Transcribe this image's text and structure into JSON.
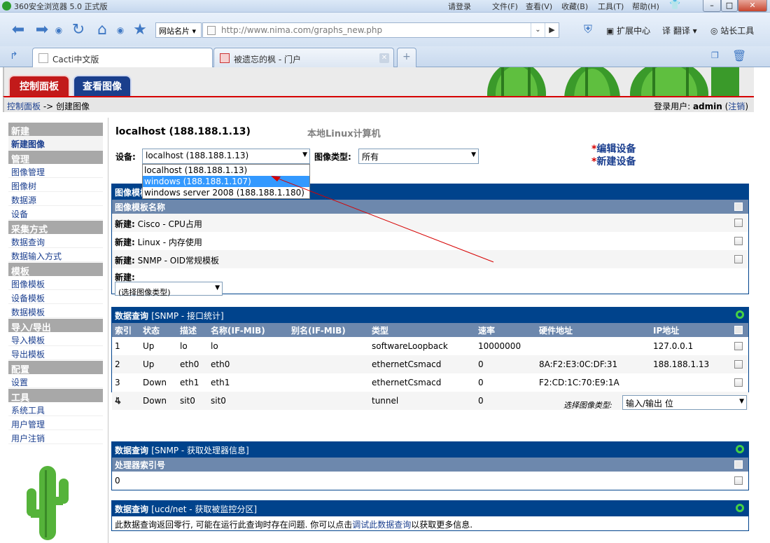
{
  "browser": {
    "title": "360安全浏览器 5.0 正式版",
    "menu": [
      "请登录",
      "文件(F)",
      "查看(V)",
      "收藏(B)",
      "工具(T)",
      "帮助(H)"
    ],
    "address_combo": "网站名片",
    "url": "http://www.nima.com/graphs_new.php",
    "tools": {
      "ext": "扩展中心",
      "translate": "翻译",
      "webmaster": "站长工具"
    },
    "tabs": [
      {
        "label": "Cacti中文版"
      },
      {
        "label": "被遗忘的枫 - 门户"
      }
    ]
  },
  "cacti": {
    "tabs": {
      "console": "控制面板",
      "graphs": "查看图像"
    },
    "breadcrumb": {
      "home": "控制面板",
      "sep": " -> ",
      "current": "创建图像"
    },
    "user": {
      "prefix": "登录用户: ",
      "name": "admin",
      "logout": "注销"
    }
  },
  "sidebar": [
    {
      "type": "head",
      "label": "新建"
    },
    {
      "type": "item",
      "label": "新建图像",
      "active": true
    },
    {
      "type": "head",
      "label": "管理"
    },
    {
      "type": "item",
      "label": "图像管理"
    },
    {
      "type": "item",
      "label": "图像树"
    },
    {
      "type": "item",
      "label": "数据源"
    },
    {
      "type": "item",
      "label": "设备"
    },
    {
      "type": "head",
      "label": "采集方式"
    },
    {
      "type": "item",
      "label": "数据查询"
    },
    {
      "type": "item",
      "label": "数据输入方式"
    },
    {
      "type": "head",
      "label": "模板"
    },
    {
      "type": "item",
      "label": "图像模板"
    },
    {
      "type": "item",
      "label": "设备模板"
    },
    {
      "type": "item",
      "label": "数据模板"
    },
    {
      "type": "head",
      "label": "导入/导出"
    },
    {
      "type": "item",
      "label": "导入模板"
    },
    {
      "type": "item",
      "label": "导出模板"
    },
    {
      "type": "head",
      "label": "配置"
    },
    {
      "type": "item",
      "label": "设置"
    },
    {
      "type": "head",
      "label": "工具"
    },
    {
      "type": "item",
      "label": "系统工具"
    },
    {
      "type": "item",
      "label": "用户管理"
    },
    {
      "type": "item",
      "label": "用户注销"
    }
  ],
  "main": {
    "host_title": "localhost (188.188.1.13)",
    "host_desc": "本地Linux计算机",
    "device_label": "设备:",
    "device_value": "localhost (188.188.1.13)",
    "device_options": [
      "localhost (188.188.1.13)",
      "windows (188.188.1.107)",
      "windows server 2008 (188.188.1.180)"
    ],
    "graph_type_label": "图像类型:",
    "graph_type_value": "所有",
    "edit_device": "编辑设备",
    "new_device": "新建设备",
    "star": "*"
  },
  "templates_panel": {
    "title": "图像模板",
    "col": "图像模板名称",
    "rows": [
      {
        "prefix": "新建:",
        "name": "Cisco - CPU占用"
      },
      {
        "prefix": "新建:",
        "name": "Linux - 内存使用"
      },
      {
        "prefix": "新建:",
        "name": "SNMP - OID常规模板"
      }
    ],
    "new_prefix": "新建:",
    "new_select": "(选择图像类型)"
  },
  "query_if": {
    "title": "数据查询",
    "sub": "[SNMP - 接口统计]",
    "columns": [
      "索引",
      "状态",
      "描述",
      "名称(IF-MIB)",
      "别名(IF-MIB)",
      "类型",
      "速率",
      "硬件地址",
      "IP地址"
    ],
    "rows": [
      [
        "1",
        "Up",
        "lo",
        "lo",
        "",
        "softwareLoopback",
        "10000000",
        "",
        "127.0.0.1"
      ],
      [
        "2",
        "Up",
        "eth0",
        "eth0",
        "",
        "ethernetCsmacd",
        "0",
        "8A:F2:E3:0C:DF:31",
        "188.188.1.13"
      ],
      [
        "3",
        "Down",
        "eth1",
        "eth1",
        "",
        "ethernetCsmacd",
        "0",
        "F2:CD:1C:70:E9:1A",
        ""
      ],
      [
        "4",
        "Down",
        "sit0",
        "sit0",
        "",
        "tunnel",
        "0",
        "",
        ""
      ]
    ],
    "type_label": "选择图像类型:",
    "type_value": "输入/输出 位"
  },
  "query_cpu": {
    "title": "数据查询",
    "sub": "[SNMP - 获取处理器信息]",
    "col": "处理器索引号",
    "rows": [
      [
        "0"
      ]
    ]
  },
  "query_ucd": {
    "title": "数据查询",
    "sub": "[ucd/net - 获取被监控分区]",
    "msg_before": "此数据查询返回零行, 可能在运行此查询时存在问题. 你可以点击",
    "msg_link": "调试此数据查询",
    "msg_after": "以获取更多信息."
  },
  "colors": {
    "panel_header": "#00438c",
    "column_header": "#6d88ad",
    "sidebar_header": "#a8a8a8",
    "accent_red": "#d60000",
    "status_ok": "#45d045"
  }
}
